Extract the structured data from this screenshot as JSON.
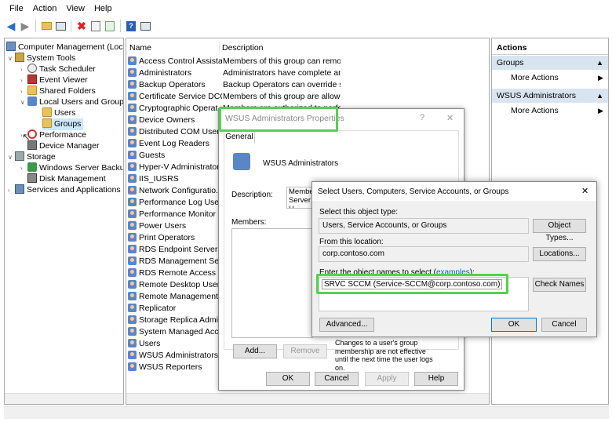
{
  "menu": [
    "File",
    "Action",
    "View",
    "Help"
  ],
  "tree": {
    "root": "Computer Management (Local)",
    "system_tools": "System Tools",
    "task_scheduler": "Task Scheduler",
    "event_viewer": "Event Viewer",
    "shared_folders": "Shared Folders",
    "local_users_groups": "Local Users and Groups",
    "users": "Users",
    "groups": "Groups",
    "performance": "Performance",
    "device_manager": "Device Manager",
    "storage": "Storage",
    "wsb": "Windows Server Backup",
    "disk_mgmt": "Disk Management",
    "services": "Services and Applications"
  },
  "list": {
    "col_name": "Name",
    "col_desc": "Description",
    "rows": [
      {
        "name": "Access Control Assista...",
        "desc": "Members of this group can remot..."
      },
      {
        "name": "Administrators",
        "desc": "Administrators have complete and..."
      },
      {
        "name": "Backup Operators",
        "desc": "Backup Operators can override sec..."
      },
      {
        "name": "Certificate Service DCO...",
        "desc": "Members of this group are allowe..."
      },
      {
        "name": "Cryptographic Operat...",
        "desc": "Members are authorized to perfor..."
      },
      {
        "name": "Device Owners",
        "desc": ""
      },
      {
        "name": "Distributed COM Users",
        "desc": ""
      },
      {
        "name": "Event Log Readers",
        "desc": ""
      },
      {
        "name": "Guests",
        "desc": ""
      },
      {
        "name": "Hyper-V Administrators",
        "desc": ""
      },
      {
        "name": "IIS_IUSRS",
        "desc": ""
      },
      {
        "name": "Network Configuratio...",
        "desc": ""
      },
      {
        "name": "Performance Log Users",
        "desc": ""
      },
      {
        "name": "Performance Monitor ...",
        "desc": ""
      },
      {
        "name": "Power Users",
        "desc": ""
      },
      {
        "name": "Print Operators",
        "desc": ""
      },
      {
        "name": "RDS Endpoint Servers",
        "desc": ""
      },
      {
        "name": "RDS Management Ser...",
        "desc": ""
      },
      {
        "name": "RDS Remote Access Se...",
        "desc": ""
      },
      {
        "name": "Remote Desktop Users",
        "desc": ""
      },
      {
        "name": "Remote Management ...",
        "desc": ""
      },
      {
        "name": "Replicator",
        "desc": ""
      },
      {
        "name": "Storage Replica Admin...",
        "desc": ""
      },
      {
        "name": "System Managed Acco...",
        "desc": ""
      },
      {
        "name": "Users",
        "desc": ""
      },
      {
        "name": "WSUS Administrators",
        "desc": ""
      },
      {
        "name": "WSUS Reporters",
        "desc": ""
      }
    ]
  },
  "actions": {
    "title": "Actions",
    "groups": "Groups",
    "more1": "More Actions",
    "wsus": "WSUS Administrators",
    "more2": "More Actions"
  },
  "props": {
    "title": "WSUS Administrators Properties",
    "help": "?",
    "close": "✕",
    "tab": "General",
    "group_name": "WSUS Administrators",
    "desc_label": "Description:",
    "desc_value_1": "Members",
    "desc_value_2": "Server U",
    "members_label": "Members:",
    "add": "Add...",
    "remove": "Remove",
    "note": "Changes to a user's group membership are not effective until the next time the user logs on.",
    "ok": "OK",
    "cancel": "Cancel",
    "apply": "Apply",
    "helpbtn": "Help"
  },
  "select": {
    "title": "Select Users, Computers, Service Accounts, or Groups",
    "close": "✕",
    "type_label": "Select this object type:",
    "type_value": "Users, Service Accounts, or Groups",
    "object_types": "Object Types...",
    "loc_label": "From this location:",
    "loc_value": "corp.contoso.com",
    "locations": "Locations...",
    "enter_label": "Enter the object names to select (",
    "examples": "examples",
    "enter_label_end": "):",
    "names_value": "SRVC SCCM (Service-SCCM@corp.contoso.com)",
    "check_names": "Check Names",
    "advanced": "Advanced...",
    "ok": "OK",
    "cancel": "Cancel"
  },
  "colors": {
    "highlight": "#55d14f",
    "selection": "#cce8ff",
    "actions_header": "#d9e4f1"
  }
}
